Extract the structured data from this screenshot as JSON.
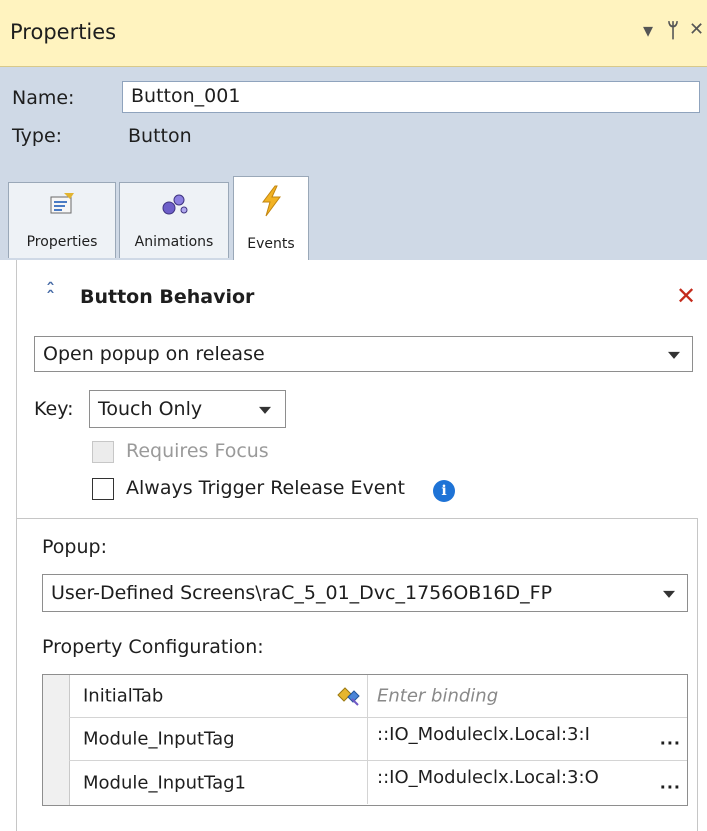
{
  "window": {
    "title": "Properties",
    "menu_glyph": "▾",
    "pin_glyph": "ᛘ",
    "close_glyph": "✕"
  },
  "header": {
    "name_label": "Name:",
    "name_value": "Button_001",
    "type_label": "Type:",
    "type_value": "Button"
  },
  "tabs": [
    {
      "label": "Properties",
      "icon": "properties-icon",
      "active": false
    },
    {
      "label": "Animations",
      "icon": "animations-icon",
      "active": false
    },
    {
      "label": "Events",
      "icon": "lightning-icon",
      "active": true
    }
  ],
  "behavior": {
    "collapse_glyph": "⌃",
    "title": "Button Behavior",
    "close_glyph": "✕",
    "action_value": "Open popup on release",
    "key_label": "Key:",
    "key_value": "Touch Only",
    "requires_focus_label": "Requires Focus",
    "always_trigger_label": "Always Trigger Release Event",
    "info_glyph": "i"
  },
  "popup": {
    "label": "Popup:",
    "value": "User-Defined Screens\\raC_5_01_Dvc_1756OB16D_FP",
    "config_label": "Property Configuration:",
    "rows": [
      {
        "name": "InitialTab",
        "value": "Enter binding",
        "placeholder": true
      },
      {
        "name": "Module_InputTag",
        "value": "::IO_Moduleclx.Local:3:I",
        "placeholder": false
      },
      {
        "name": "Module_InputTag1",
        "value": "::IO_Moduleclx.Local:3:O",
        "placeholder": false
      }
    ],
    "dots": "..."
  },
  "colors": {
    "title_bg": "#fff3bf",
    "header_bg": "#cfd9e6",
    "close_red": "#c42b1c",
    "info_blue": "#1e73d6"
  }
}
